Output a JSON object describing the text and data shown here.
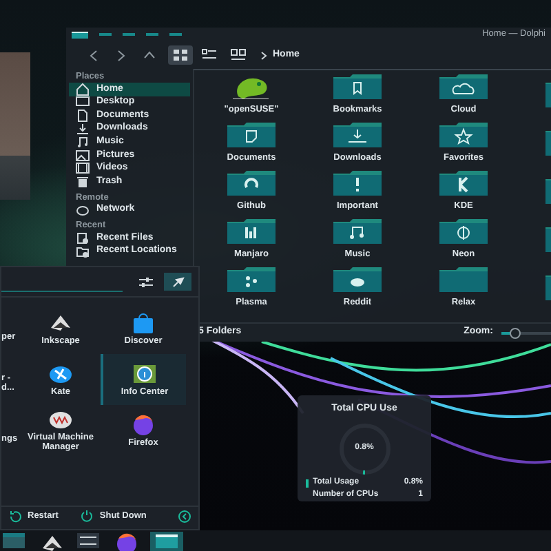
{
  "dolphin": {
    "title": "Home — Dolphi",
    "view_modes": [
      {
        "kind": "icons",
        "selected": true
      },
      {
        "kind": "details",
        "selected": false
      },
      {
        "kind": "compact",
        "selected": false
      }
    ],
    "breadcrumb": "Home",
    "sidebar": [
      {
        "heading": "Places",
        "items": [
          {
            "label": "Home",
            "kind": "home",
            "selected": true
          },
          {
            "label": "Desktop",
            "kind": "desktop",
            "selected": false
          },
          {
            "label": "Documents",
            "kind": "documents",
            "selected": false
          },
          {
            "label": "Downloads",
            "kind": "downloads",
            "selected": false
          },
          {
            "label": "Music",
            "kind": "music",
            "selected": false
          },
          {
            "label": "Pictures",
            "kind": "pictures",
            "selected": false
          },
          {
            "label": "Videos",
            "kind": "videos",
            "selected": false
          },
          {
            "label": "Trash",
            "kind": "trash",
            "selected": false
          }
        ]
      },
      {
        "heading": "Remote",
        "items": [
          {
            "label": "Network",
            "kind": "network",
            "selected": false
          }
        ]
      },
      {
        "heading": "Recent",
        "items": [
          {
            "label": "Recent Files",
            "kind": "recent-files",
            "selected": false
          },
          {
            "label": "Recent Locations",
            "kind": "recent-locations",
            "selected": false
          }
        ]
      }
    ],
    "folders": [
      {
        "label": "\"openSUSE\"",
        "kind": "chameleon"
      },
      {
        "label": "Bookmarks",
        "kind": "bookmark"
      },
      {
        "label": "Cloud",
        "kind": "cloud"
      },
      {
        "label": "Documents",
        "kind": "document"
      },
      {
        "label": "Downloads",
        "kind": "download"
      },
      {
        "label": "Favorites",
        "kind": "star"
      },
      {
        "label": "Github",
        "kind": "github"
      },
      {
        "label": "Important",
        "kind": "important"
      },
      {
        "label": "KDE",
        "kind": "kde"
      },
      {
        "label": "Manjaro",
        "kind": "manjaro"
      },
      {
        "label": "Music",
        "kind": "music"
      },
      {
        "label": "Neon",
        "kind": "neon"
      },
      {
        "label": "Plasma",
        "kind": "plasma"
      },
      {
        "label": "Reddit",
        "kind": "reddit"
      },
      {
        "label": "Relax",
        "kind": "plain"
      }
    ],
    "status": "5 Folders",
    "zoom": {
      "label": "Zoom:",
      "level": 0.2
    }
  },
  "launcher": {
    "apps": [
      {
        "label": "per",
        "kind": "none",
        "selected": false
      },
      {
        "label": "Inkscape",
        "kind": "inkscape",
        "selected": false
      },
      {
        "label": "Discover",
        "kind": "discover",
        "selected": false
      },
      {
        "label": "r -\nd...",
        "kind": "none",
        "selected": false
      },
      {
        "label": "Kate",
        "kind": "kate",
        "selected": false
      },
      {
        "label": "Info Center",
        "kind": "info",
        "selected": true
      },
      {
        "label": "ngs",
        "kind": "none",
        "selected": false
      },
      {
        "label": "Virtual Machine Manager",
        "kind": "vm",
        "selected": false
      },
      {
        "label": "Firefox",
        "kind": "firefox",
        "selected": false
      }
    ],
    "actions": [
      {
        "label": "Restart",
        "kind": "restart"
      },
      {
        "label": "Shut Down",
        "kind": "shutdown"
      },
      {
        "kind": "logout"
      }
    ]
  },
  "cpu_widget": {
    "title": "Total CPU Use",
    "reading": "0.8%",
    "level": 0.008,
    "legend": [
      {
        "label": "Total Usage",
        "value": "0.8%",
        "color": "#1abc9c"
      },
      {
        "label": "Number of CPUs",
        "value": "1"
      }
    ]
  },
  "taskbar": [
    {
      "kind": "window",
      "selected": false
    },
    {
      "kind": "inkscape",
      "selected": false
    },
    {
      "kind": "settings",
      "selected": false
    },
    {
      "kind": "firefox",
      "selected": false
    },
    {
      "kind": "dolphin",
      "selected": true
    }
  ]
}
